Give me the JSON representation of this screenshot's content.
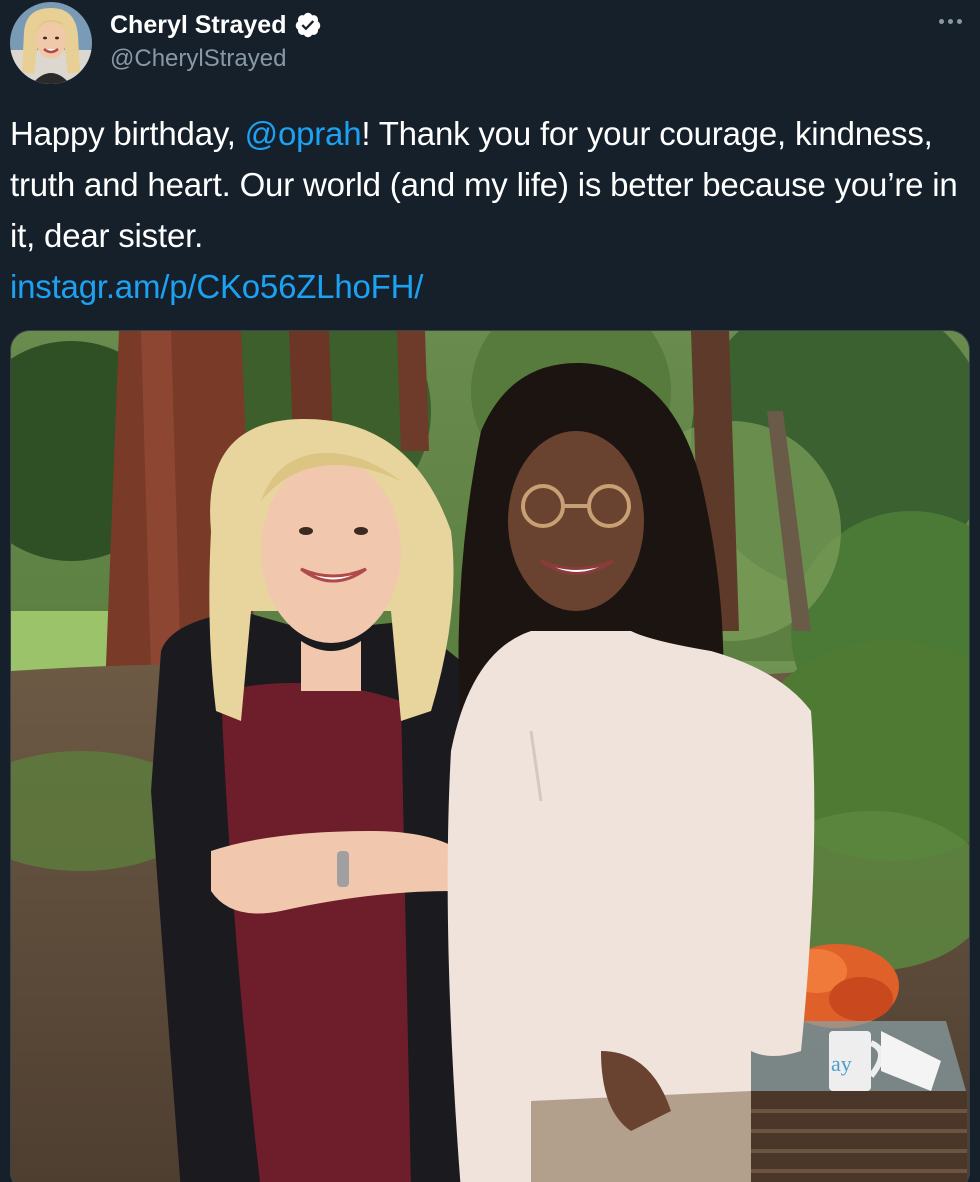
{
  "author": {
    "display_name": "Cheryl Strayed",
    "handle": "@CherylStrayed",
    "verified": true,
    "avatar_icon": "profile-photo"
  },
  "more_icon": "more-horizontal-icon",
  "tweet": {
    "text_part1": "Happy birthday, ",
    "mention": "@oprah",
    "text_part2": "! Thank you for your courage, kindness, truth and heart. Our world (and my life) is better because you’re in it, dear sister.",
    "link": "instagr.am/p/CKo56ZLhoFH/"
  },
  "media": {
    "type": "photo",
    "description_icon": "photo-two-women-in-forest",
    "mug_text": "ay"
  },
  "colors": {
    "background": "#15202b",
    "link": "#1da1f2",
    "secondary_text": "#8899a6",
    "verified_badge": "#ffffff"
  }
}
